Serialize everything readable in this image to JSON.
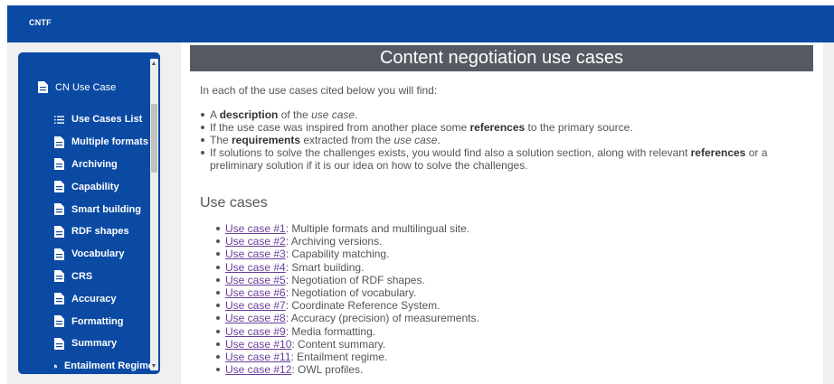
{
  "app": {
    "title": "CNTF"
  },
  "sidebar": {
    "header": "CN Use Case",
    "items": [
      {
        "label": "Use Cases List",
        "icon": "list-icon"
      },
      {
        "label": "Multiple formats",
        "icon": "document-icon"
      },
      {
        "label": "Archiving",
        "icon": "document-icon"
      },
      {
        "label": "Capability",
        "icon": "document-icon"
      },
      {
        "label": "Smart building",
        "icon": "document-icon"
      },
      {
        "label": "RDF shapes",
        "icon": "document-icon"
      },
      {
        "label": "Vocabulary",
        "icon": "document-icon"
      },
      {
        "label": "CRS",
        "icon": "document-icon"
      },
      {
        "label": "Accuracy",
        "icon": "document-icon"
      },
      {
        "label": "Formatting",
        "icon": "document-icon"
      },
      {
        "label": "Summary",
        "icon": "document-icon"
      },
      {
        "label": "Entailment Regime",
        "icon": "document-icon"
      }
    ]
  },
  "content": {
    "heading": "Content negotiation use cases",
    "intro": "In each of the use cases cited below you will find:",
    "features": [
      {
        "parts": [
          [
            "A ",
            ""
          ],
          [
            "description",
            "b"
          ],
          [
            " of the ",
            ""
          ],
          [
            "use case",
            "i"
          ],
          [
            ".",
            ""
          ]
        ]
      },
      {
        "parts": [
          [
            "If the use case was inspired from another place some ",
            ""
          ],
          [
            "references",
            "b"
          ],
          [
            " to the primary source.",
            ""
          ]
        ]
      },
      {
        "parts": [
          [
            "The ",
            ""
          ],
          [
            "requirements",
            "b"
          ],
          [
            " extracted from the ",
            ""
          ],
          [
            "use case",
            "i"
          ],
          [
            ".",
            ""
          ]
        ]
      },
      {
        "parts": [
          [
            "If solutions to solve the challenges exists, you would find also a solution section, along with relevant ",
            ""
          ],
          [
            "references",
            "b"
          ],
          [
            " or a preliminary solution if it is our idea on how to solve the challenges.",
            ""
          ]
        ]
      }
    ],
    "use_cases_heading": "Use cases",
    "use_cases": [
      {
        "link": "Use case #1",
        "text": ": Multiple formats and multilingual site."
      },
      {
        "link": "Use case #2",
        "text": ": Archiving versions."
      },
      {
        "link": "Use case #3",
        "text": ": Capability matching."
      },
      {
        "link": "Use case #4",
        "text": ": Smart building."
      },
      {
        "link": "Use case #5",
        "text": ": Negotiation of RDF shapes."
      },
      {
        "link": "Use case #6",
        "text": ": Negotiation of vocabulary."
      },
      {
        "link": "Use case #7",
        "text": ": Coordinate Reference System."
      },
      {
        "link": "Use case #8",
        "text": ": Accuracy (precision) of measurements."
      },
      {
        "link": "Use case #9",
        "text": ": Media formatting."
      },
      {
        "link": "Use case #10",
        "text": ": Content summary."
      },
      {
        "link": "Use case #11",
        "text": ": Entailment regime."
      },
      {
        "link": "Use case #12",
        "text": ": OWL profiles."
      }
    ]
  },
  "colors": {
    "primary": "#0a4aa3",
    "heading_bar": "#555a62",
    "link": "#6a3d9a"
  }
}
